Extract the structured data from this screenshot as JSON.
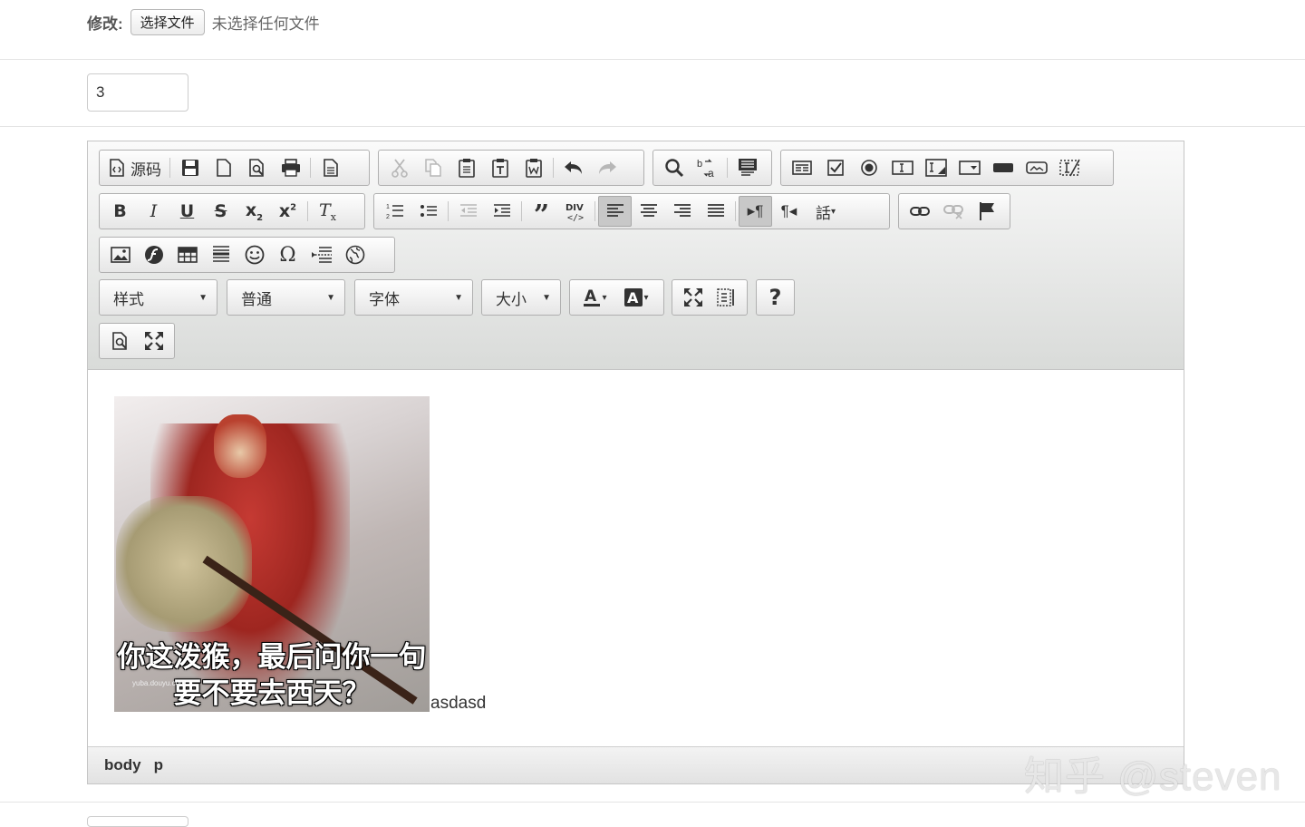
{
  "file_row": {
    "label": "修改:",
    "button": "选择文件",
    "status": "未选择任何文件"
  },
  "number_field": {
    "value": "3"
  },
  "toolbar": {
    "source_label": "源码",
    "styles_combo": "样式",
    "format_combo": "普通",
    "font_combo": "字体",
    "size_combo": "大小",
    "help": "?"
  },
  "content": {
    "image_caption_line1": "你这泼猴，最后问你一句",
    "image_caption_line2": "要不要去西天？",
    "image_watermark": "yuba.douyu.com",
    "trailing_text": "asdasd"
  },
  "status_bar": {
    "path": [
      "body",
      "p"
    ]
  },
  "watermark": "知乎 @steven"
}
